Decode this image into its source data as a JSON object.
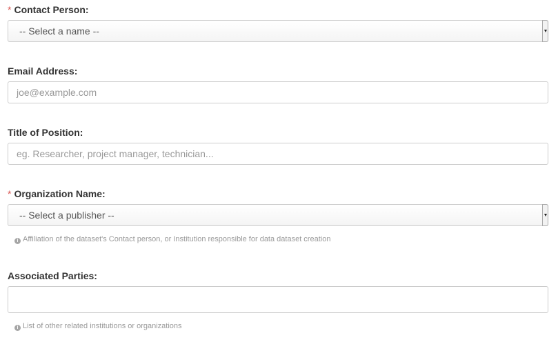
{
  "form": {
    "contact_person": {
      "required_mark": "*",
      "label": "Contact Person:",
      "selected": "-- Select a name --"
    },
    "email": {
      "label": "Email Address:",
      "placeholder": "joe@example.com"
    },
    "position": {
      "label": "Title of Position:",
      "placeholder": "eg. Researcher, project manager, technician..."
    },
    "organization": {
      "required_mark": "*",
      "label": "Organization Name:",
      "selected": "-- Select a publisher --",
      "help": "Affiliation of the dataset's Contact person, or Institution responsible for data dataset creation"
    },
    "associated_parties": {
      "label": "Associated Parties:",
      "value": "",
      "help": "List of other related institutions or organizations"
    }
  },
  "icons": {
    "info": "info-circle-icon",
    "dropdown": "chevron-down-icon"
  },
  "colors": {
    "required": "#d9534f",
    "help_text": "#999999",
    "border": "#cccccc"
  }
}
